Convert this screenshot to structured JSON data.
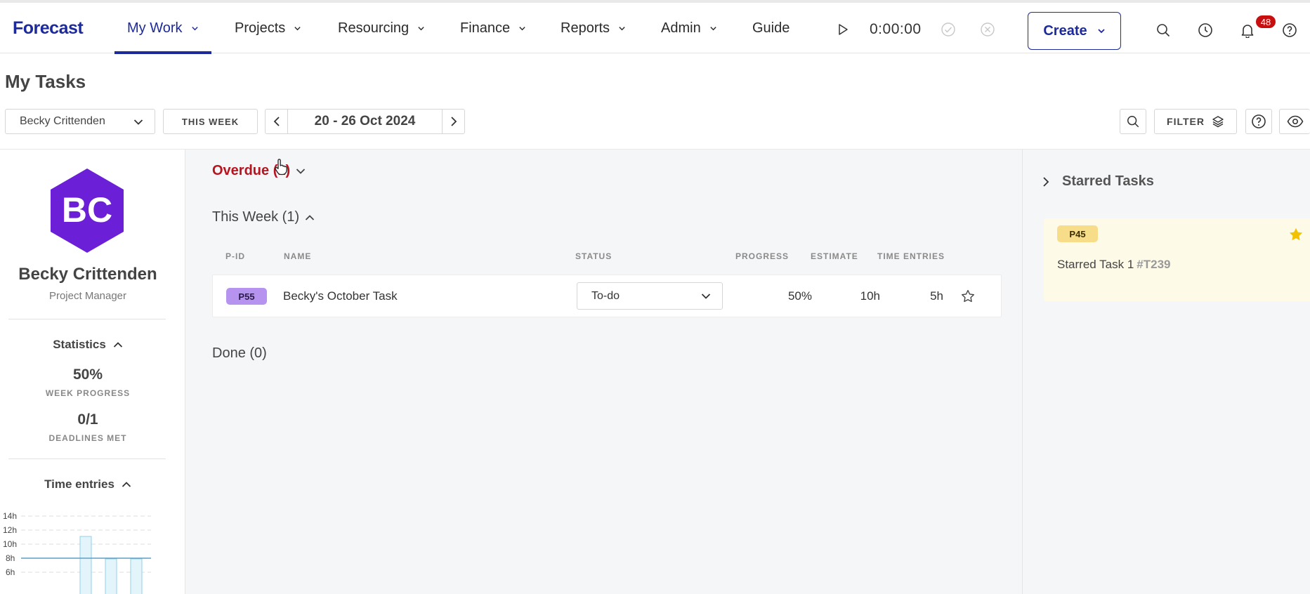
{
  "app": {
    "logo": "Forecast"
  },
  "nav": [
    {
      "label": "My Work"
    },
    {
      "label": "Projects"
    },
    {
      "label": "Resourcing"
    },
    {
      "label": "Finance"
    },
    {
      "label": "Reports"
    },
    {
      "label": "Admin"
    },
    {
      "label": "Guide"
    }
  ],
  "timer": {
    "value": "0:00:00"
  },
  "create_label": "Create",
  "notifications": {
    "count": "48"
  },
  "page": {
    "title": "My Tasks"
  },
  "filters": {
    "person": "Becky Crittenden",
    "this_week_label": "THIS WEEK",
    "date_range": "20 - 26 Oct 2024",
    "filter_label": "FILTER"
  },
  "profile": {
    "initials": "BC",
    "name": "Becky Crittenden",
    "role": "Project Manager",
    "avatar_color": "#6b1fd6"
  },
  "statistics": {
    "title": "Statistics",
    "week_progress_value": "50%",
    "week_progress_label": "WEEK PROGRESS",
    "deadlines_value": "0/1",
    "deadlines_label": "DEADLINES MET"
  },
  "time_entries": {
    "title": "Time entries",
    "y_ticks": [
      "14h",
      "12h",
      "10h",
      "8h",
      "6h"
    ]
  },
  "groups": {
    "overdue": "Overdue (1)",
    "this_week": "This Week (1)",
    "done": "Done (0)"
  },
  "columns": [
    "P-ID",
    "NAME",
    "STATUS",
    "PROGRESS",
    "ESTIMATE",
    "TIME ENTRIES"
  ],
  "tasks": [
    {
      "pid": "P55",
      "name": "Becky's October Task",
      "status": "To-do",
      "progress": "50%",
      "estimate": "10h",
      "time_entries": "5h",
      "pid_color": "#b593ee"
    }
  ],
  "starred": {
    "title": "Starred Tasks",
    "items": [
      {
        "pid": "P45",
        "name": "Starred Task 1",
        "task_id": "#T239"
      }
    ]
  },
  "colors": {
    "brand": "#1d2a9c",
    "overdue": "#b8141f",
    "badge": "#c80f0f",
    "star": "#f2c200"
  }
}
